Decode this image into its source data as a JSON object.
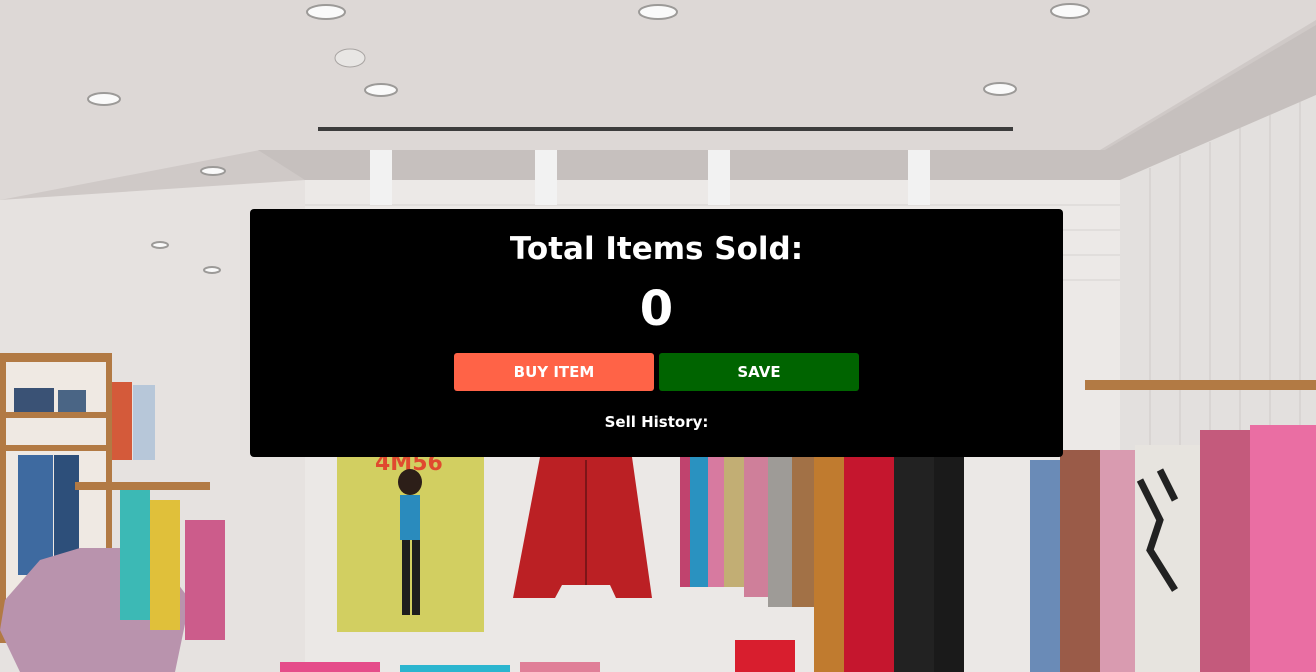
{
  "panel": {
    "title": "Total Items Sold:",
    "count": "0",
    "buy_label": "BUY ITEM",
    "save_label": "SAVE",
    "history_label": "Sell History:"
  },
  "background": {
    "poster_text": "4M56"
  },
  "colors": {
    "panel_bg": "#000000",
    "buy_button": "#ff6347",
    "save_button": "#006400",
    "text": "#ffffff"
  }
}
